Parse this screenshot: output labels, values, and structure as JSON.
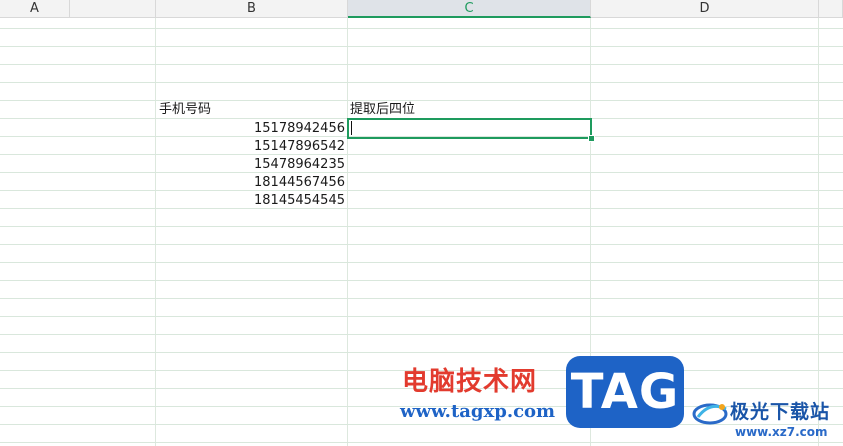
{
  "columns": [
    "A",
    "B",
    "C",
    "D"
  ],
  "active_column": "C",
  "cells": {
    "B_header": "手机号码",
    "C_header": "提取后四位",
    "phones": [
      "15178942456",
      "15147896542",
      "15478964235",
      "18144567456",
      "18145454545"
    ]
  },
  "selected_cell": "C7",
  "watermark": {
    "site_name": "电脑技术网",
    "site_url": "www.tagxp.com",
    "tag": "TAG",
    "logo_name": "极光下载站",
    "logo_url": "www.xz7.com"
  },
  "colors": {
    "grid": "#d9e7dc",
    "selection": "#1e9b5e",
    "header_bg": "#f3f3f3",
    "header_active_bg": "#dfe3e8"
  }
}
